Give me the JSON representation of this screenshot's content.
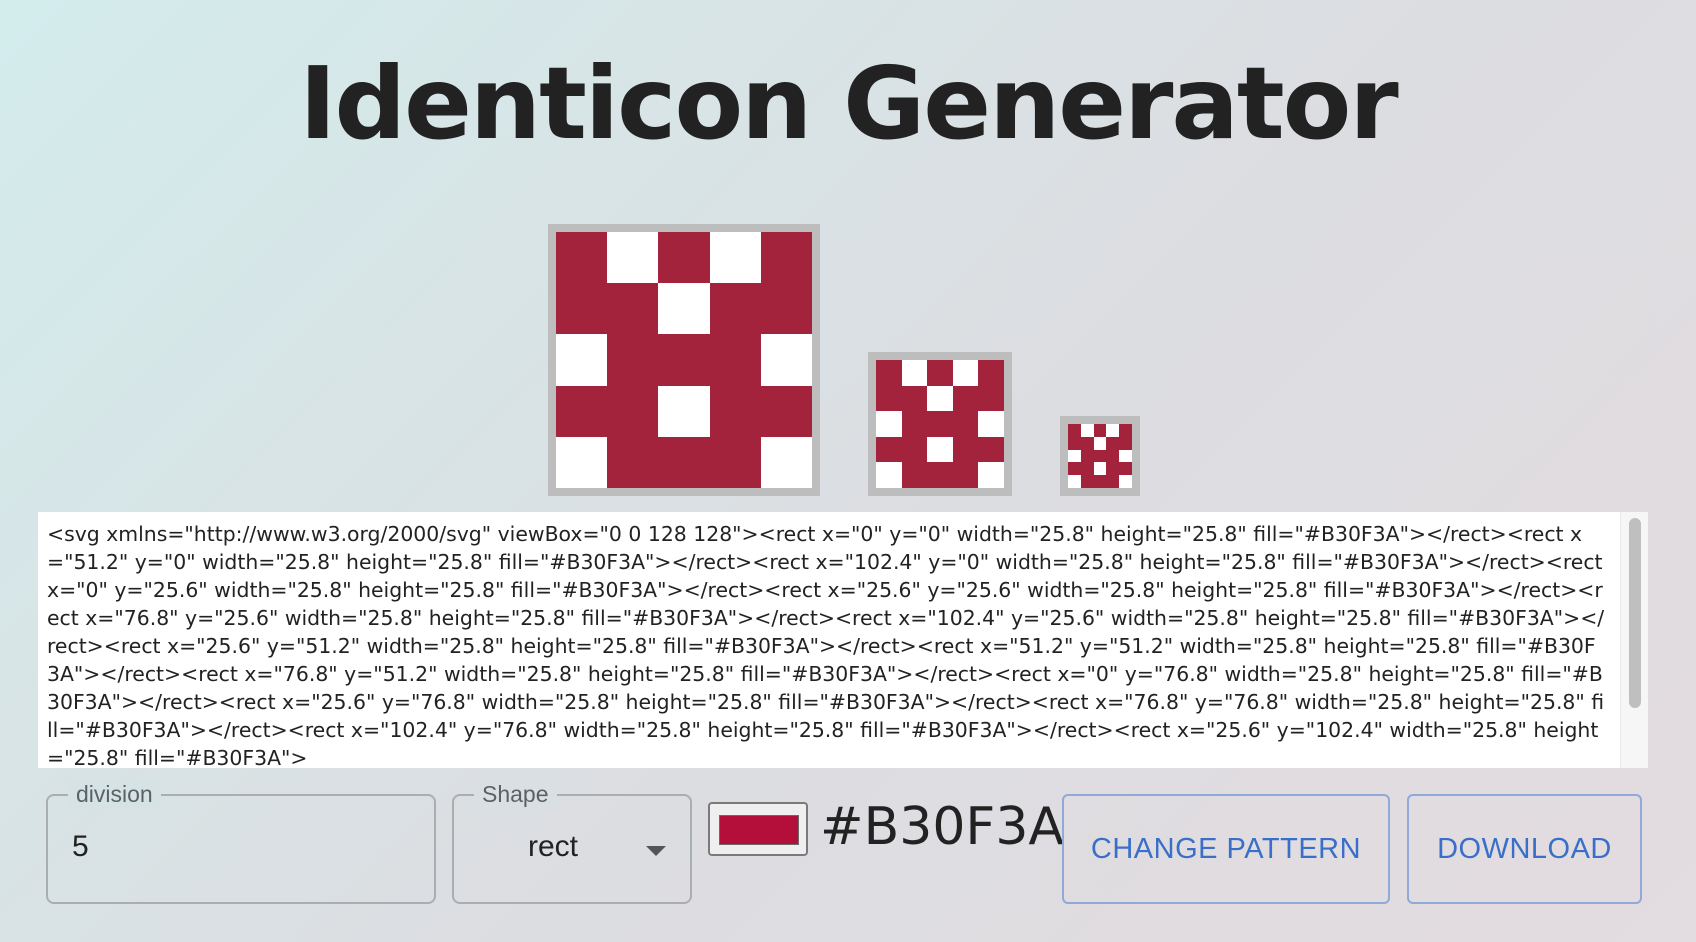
{
  "page": {
    "title": "Identicon Generator"
  },
  "identicon": {
    "color": "#B30F3A",
    "division": 5,
    "pattern": [
      [
        1,
        0,
        1,
        0,
        1
      ],
      [
        1,
        1,
        0,
        1,
        1
      ],
      [
        0,
        1,
        1,
        1,
        0
      ],
      [
        1,
        1,
        0,
        1,
        1
      ],
      [
        0,
        1,
        1,
        1,
        0
      ]
    ]
  },
  "svg_code": "<svg xmlns=\"http://www.w3.org/2000/svg\" viewBox=\"0 0 128 128\"><rect x=\"0\" y=\"0\" width=\"25.8\" height=\"25.8\" fill=\"#B30F3A\"></rect><rect x=\"51.2\" y=\"0\" width=\"25.8\" height=\"25.8\" fill=\"#B30F3A\"></rect><rect x=\"102.4\" y=\"0\" width=\"25.8\" height=\"25.8\" fill=\"#B30F3A\"></rect><rect x=\"0\" y=\"25.6\" width=\"25.8\" height=\"25.8\" fill=\"#B30F3A\"></rect><rect x=\"25.6\" y=\"25.6\" width=\"25.8\" height=\"25.8\" fill=\"#B30F3A\"></rect><rect x=\"76.8\" y=\"25.6\" width=\"25.8\" height=\"25.8\" fill=\"#B30F3A\"></rect><rect x=\"102.4\" y=\"25.6\" width=\"25.8\" height=\"25.8\" fill=\"#B30F3A\"></rect><rect x=\"25.6\" y=\"51.2\" width=\"25.8\" height=\"25.8\" fill=\"#B30F3A\"></rect><rect x=\"51.2\" y=\"51.2\" width=\"25.8\" height=\"25.8\" fill=\"#B30F3A\"></rect><rect x=\"76.8\" y=\"51.2\" width=\"25.8\" height=\"25.8\" fill=\"#B30F3A\"></rect><rect x=\"0\" y=\"76.8\" width=\"25.8\" height=\"25.8\" fill=\"#B30F3A\"></rect><rect x=\"25.6\" y=\"76.8\" width=\"25.8\" height=\"25.8\" fill=\"#B30F3A\"></rect><rect x=\"76.8\" y=\"76.8\" width=\"25.8\" height=\"25.8\" fill=\"#B30F3A\"></rect><rect x=\"102.4\" y=\"76.8\" width=\"25.8\" height=\"25.8\" fill=\"#B30F3A\"></rect><rect x=\"25.6\" y=\"102.4\" width=\"25.8\" height=\"25.8\" fill=\"#B30F3A\">",
  "controls": {
    "division": {
      "label": "division",
      "value": "5"
    },
    "shape": {
      "label": "Shape",
      "value": "rect"
    },
    "color_hex": "#B30F3A",
    "change_pattern_label": "CHANGE PATTERN",
    "download_label": "DOWNLOAD"
  },
  "colors": {
    "cell_on": "#a3233c",
    "button_text": "#3a6fc9",
    "button_border": "#8fa9d8"
  }
}
